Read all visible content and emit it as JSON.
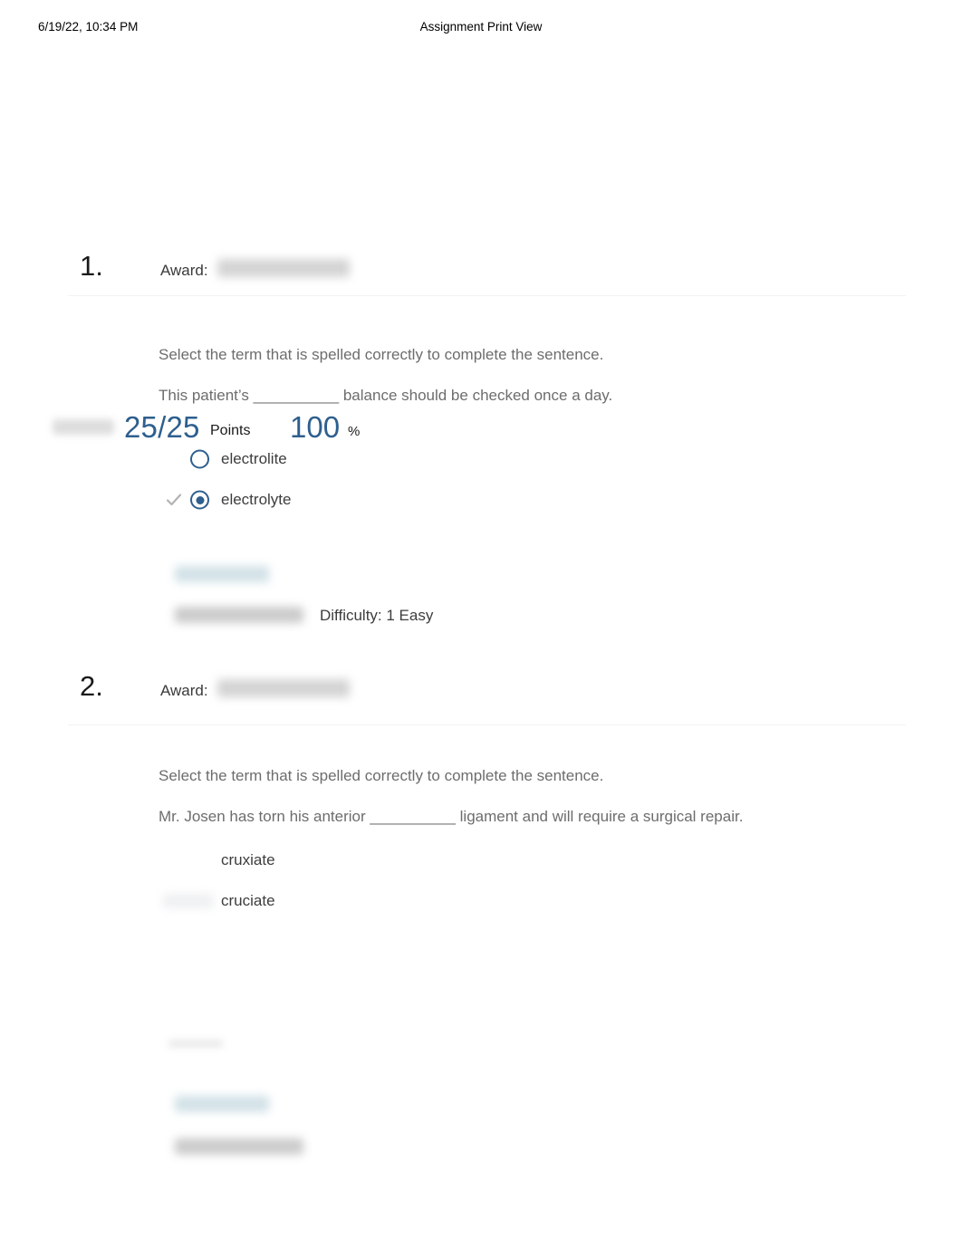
{
  "page": {
    "header": {
      "date": "6/19/22, 10:34 PM",
      "title": "Assignment Print View"
    },
    "score": {
      "score_label_redacted": "",
      "points": "25/25",
      "points_label": "Points",
      "percent": "100",
      "percent_sign": "%"
    }
  },
  "questions": [
    {
      "number": "1.",
      "award_label": "Award:",
      "award_value_redacted": "",
      "prompt": "Select the term that is spelled correctly to complete the sentence.",
      "sentence": "This patient’s __________ balance should be checked once a day.",
      "options": [
        {
          "label": "electrolite",
          "selected": false,
          "correct_mark": false,
          "control_visible": true
        },
        {
          "label": "electrolyte",
          "selected": true,
          "correct_mark": true,
          "control_visible": true
        }
      ],
      "meta": {
        "tag_redacted": "",
        "source_redacted": "",
        "difficulty": "Difficulty: 1 Easy"
      }
    },
    {
      "number": "2.",
      "award_label": "Award:",
      "award_value_redacted": "",
      "prompt": "Select the term that is spelled correctly to complete the sentence.",
      "sentence": "Mr. Josen has torn his anterior __________ ligament and will require a surgical repair.",
      "options": [
        {
          "label": "cruxiate",
          "selected": false,
          "correct_mark": false,
          "control_visible": false
        },
        {
          "label": "cruciate",
          "selected": false,
          "correct_mark": false,
          "control_visible": false
        }
      ],
      "meta": {
        "tag_redacted": "",
        "source_redacted": "",
        "difficulty": ""
      }
    }
  ],
  "colors": {
    "accent_blue": "#2e5f8e",
    "body_text": "#6d6d6d",
    "option_text": "#3d3d3d",
    "divider": "#f1f2f4",
    "check_grey": "#b3b3b3"
  }
}
